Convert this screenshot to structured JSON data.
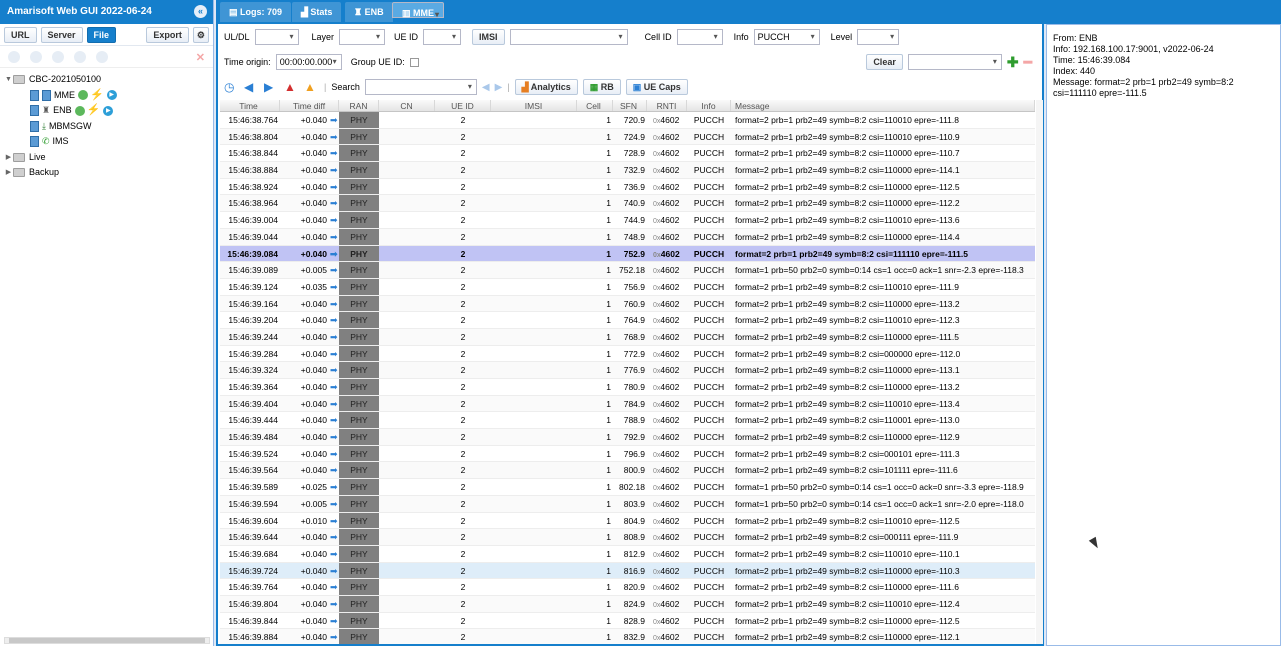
{
  "app": {
    "title": "Amarisoft Web GUI 2022-06-24"
  },
  "left_toolbar": {
    "url": "URL",
    "server": "Server",
    "file": "File",
    "export": "Export"
  },
  "tree": {
    "root": "CBC-2021050100",
    "nodes": [
      {
        "label": "MME",
        "icon": "server-icon"
      },
      {
        "label": "ENB",
        "icon": "antenna-icon"
      },
      {
        "label": "MBMSGW",
        "icon": "download-icon"
      },
      {
        "label": "IMS",
        "icon": "phone-icon"
      }
    ],
    "live": "Live",
    "backup": "Backup"
  },
  "tabs": [
    {
      "label": "Logs: 709",
      "icon": "list-icon"
    },
    {
      "label": "Stats",
      "icon": "chart-icon"
    },
    {
      "label": "ENB",
      "icon": "antenna-icon"
    },
    {
      "label": "MME",
      "icon": "server-icon"
    }
  ],
  "filters": {
    "uldl_label": "UL/DL",
    "layer_label": "Layer",
    "ueid_label": "UE ID",
    "imsi_label": "IMSI",
    "cellid_label": "Cell ID",
    "info_label": "Info",
    "info_value": "PUCCH",
    "level_label": "Level",
    "time_origin_label": "Time origin:",
    "time_origin_value": "00:00:00.000",
    "group_ueid_label": "Group UE ID:",
    "clear": "Clear",
    "search_label": "Search",
    "analytics": "Analytics",
    "rb": "RB",
    "uecaps": "UE Caps"
  },
  "columns": [
    "Time",
    "Time diff",
    "RAN",
    "CN",
    "UE ID",
    "IMSI",
    "Cell",
    "SFN",
    "RNTI",
    "Info",
    "Message"
  ],
  "rows": [
    [
      "15:46:38.764",
      "+0.040",
      "PHY",
      "2",
      "1",
      "720.9",
      "0x",
      "4602",
      "PUCCH",
      "format=2 prb=1 prb2=49 symb=8:2 csi=110010 epre=-111.8"
    ],
    [
      "15:46:38.804",
      "+0.040",
      "PHY",
      "2",
      "1",
      "724.9",
      "0x",
      "4602",
      "PUCCH",
      "format=2 prb=1 prb2=49 symb=8:2 csi=110010 epre=-110.9"
    ],
    [
      "15:46:38.844",
      "+0.040",
      "PHY",
      "2",
      "1",
      "728.9",
      "0x",
      "4602",
      "PUCCH",
      "format=2 prb=1 prb2=49 symb=8:2 csi=110000 epre=-110.7"
    ],
    [
      "15:46:38.884",
      "+0.040",
      "PHY",
      "2",
      "1",
      "732.9",
      "0x",
      "4602",
      "PUCCH",
      "format=2 prb=1 prb2=49 symb=8:2 csi=110000 epre=-114.1"
    ],
    [
      "15:46:38.924",
      "+0.040",
      "PHY",
      "2",
      "1",
      "736.9",
      "0x",
      "4602",
      "PUCCH",
      "format=2 prb=1 prb2=49 symb=8:2 csi=110000 epre=-112.5"
    ],
    [
      "15:46:38.964",
      "+0.040",
      "PHY",
      "2",
      "1",
      "740.9",
      "0x",
      "4602",
      "PUCCH",
      "format=2 prb=1 prb2=49 symb=8:2 csi=110000 epre=-112.2"
    ],
    [
      "15:46:39.004",
      "+0.040",
      "PHY",
      "2",
      "1",
      "744.9",
      "0x",
      "4602",
      "PUCCH",
      "format=2 prb=1 prb2=49 symb=8:2 csi=110010 epre=-113.6"
    ],
    [
      "15:46:39.044",
      "+0.040",
      "PHY",
      "2",
      "1",
      "748.9",
      "0x",
      "4602",
      "PUCCH",
      "format=2 prb=1 prb2=49 symb=8:2 csi=110000 epre=-114.4"
    ],
    [
      "15:46:39.084",
      "+0.040",
      "PHY",
      "2",
      "1",
      "752.9",
      "0x",
      "4602",
      "PUCCH",
      "format=2 prb=1 prb2=49 symb=8:2 csi=111110 epre=-111.5"
    ],
    [
      "15:46:39.089",
      "+0.005",
      "PHY",
      "2",
      "1",
      "752.18",
      "0x",
      "4602",
      "PUCCH",
      "format=1 prb=50 prb2=0 symb=0:14 cs=1 occ=0 ack=1 snr=-2.3 epre=-118.3"
    ],
    [
      "15:46:39.124",
      "+0.035",
      "PHY",
      "2",
      "1",
      "756.9",
      "0x",
      "4602",
      "PUCCH",
      "format=2 prb=1 prb2=49 symb=8:2 csi=110010 epre=-111.9"
    ],
    [
      "15:46:39.164",
      "+0.040",
      "PHY",
      "2",
      "1",
      "760.9",
      "0x",
      "4602",
      "PUCCH",
      "format=2 prb=1 prb2=49 symb=8:2 csi=110000 epre=-113.2"
    ],
    [
      "15:46:39.204",
      "+0.040",
      "PHY",
      "2",
      "1",
      "764.9",
      "0x",
      "4602",
      "PUCCH",
      "format=2 prb=1 prb2=49 symb=8:2 csi=110010 epre=-112.3"
    ],
    [
      "15:46:39.244",
      "+0.040",
      "PHY",
      "2",
      "1",
      "768.9",
      "0x",
      "4602",
      "PUCCH",
      "format=2 prb=1 prb2=49 symb=8:2 csi=110000 epre=-111.5"
    ],
    [
      "15:46:39.284",
      "+0.040",
      "PHY",
      "2",
      "1",
      "772.9",
      "0x",
      "4602",
      "PUCCH",
      "format=2 prb=1 prb2=49 symb=8:2 csi=000000 epre=-112.0"
    ],
    [
      "15:46:39.324",
      "+0.040",
      "PHY",
      "2",
      "1",
      "776.9",
      "0x",
      "4602",
      "PUCCH",
      "format=2 prb=1 prb2=49 symb=8:2 csi=110000 epre=-113.1"
    ],
    [
      "15:46:39.364",
      "+0.040",
      "PHY",
      "2",
      "1",
      "780.9",
      "0x",
      "4602",
      "PUCCH",
      "format=2 prb=1 prb2=49 symb=8:2 csi=110000 epre=-113.2"
    ],
    [
      "15:46:39.404",
      "+0.040",
      "PHY",
      "2",
      "1",
      "784.9",
      "0x",
      "4602",
      "PUCCH",
      "format=2 prb=1 prb2=49 symb=8:2 csi=110010 epre=-113.4"
    ],
    [
      "15:46:39.444",
      "+0.040",
      "PHY",
      "2",
      "1",
      "788.9",
      "0x",
      "4602",
      "PUCCH",
      "format=2 prb=1 prb2=49 symb=8:2 csi=110001 epre=-113.0"
    ],
    [
      "15:46:39.484",
      "+0.040",
      "PHY",
      "2",
      "1",
      "792.9",
      "0x",
      "4602",
      "PUCCH",
      "format=2 prb=1 prb2=49 symb=8:2 csi=110000 epre=-112.9"
    ],
    [
      "15:46:39.524",
      "+0.040",
      "PHY",
      "2",
      "1",
      "796.9",
      "0x",
      "4602",
      "PUCCH",
      "format=2 prb=1 prb2=49 symb=8:2 csi=000101 epre=-111.3"
    ],
    [
      "15:46:39.564",
      "+0.040",
      "PHY",
      "2",
      "1",
      "800.9",
      "0x",
      "4602",
      "PUCCH",
      "format=2 prb=1 prb2=49 symb=8:2 csi=101111 epre=-111.6"
    ],
    [
      "15:46:39.589",
      "+0.025",
      "PHY",
      "2",
      "1",
      "802.18",
      "0x",
      "4602",
      "PUCCH",
      "format=1 prb=50 prb2=0 symb=0:14 cs=1 occ=0 ack=0 snr=-3.3 epre=-118.9"
    ],
    [
      "15:46:39.594",
      "+0.005",
      "PHY",
      "2",
      "1",
      "803.9",
      "0x",
      "4602",
      "PUCCH",
      "format=1 prb=50 prb2=0 symb=0:14 cs=1 occ=0 ack=1 snr=-2.0 epre=-118.0"
    ],
    [
      "15:46:39.604",
      "+0.010",
      "PHY",
      "2",
      "1",
      "804.9",
      "0x",
      "4602",
      "PUCCH",
      "format=2 prb=1 prb2=49 symb=8:2 csi=110010 epre=-112.5"
    ],
    [
      "15:46:39.644",
      "+0.040",
      "PHY",
      "2",
      "1",
      "808.9",
      "0x",
      "4602",
      "PUCCH",
      "format=2 prb=1 prb2=49 symb=8:2 csi=000111 epre=-111.9"
    ],
    [
      "15:46:39.684",
      "+0.040",
      "PHY",
      "2",
      "1",
      "812.9",
      "0x",
      "4602",
      "PUCCH",
      "format=2 prb=1 prb2=49 symb=8:2 csi=110010 epre=-110.1"
    ],
    [
      "15:46:39.724",
      "+0.040",
      "PHY",
      "2",
      "1",
      "816.9",
      "0x",
      "4602",
      "PUCCH",
      "format=2 prb=1 prb2=49 symb=8:2 csi=110000 epre=-110.3"
    ],
    [
      "15:46:39.764",
      "+0.040",
      "PHY",
      "2",
      "1",
      "820.9",
      "0x",
      "4602",
      "PUCCH",
      "format=2 prb=1 prb2=49 symb=8:2 csi=110000 epre=-111.6"
    ],
    [
      "15:46:39.804",
      "+0.040",
      "PHY",
      "2",
      "1",
      "824.9",
      "0x",
      "4602",
      "PUCCH",
      "format=2 prb=1 prb2=49 symb=8:2 csi=110010 epre=-112.4"
    ],
    [
      "15:46:39.844",
      "+0.040",
      "PHY",
      "2",
      "1",
      "828.9",
      "0x",
      "4602",
      "PUCCH",
      "format=2 prb=1 prb2=49 symb=8:2 csi=110000 epre=-112.5"
    ],
    [
      "15:46:39.884",
      "+0.040",
      "PHY",
      "2",
      "1",
      "832.9",
      "0x",
      "4602",
      "PUCCH",
      "format=2 prb=1 prb2=49 symb=8:2 csi=110000 epre=-112.1"
    ]
  ],
  "selected_row": 8,
  "hover_row": 27,
  "detail": {
    "from": "From: ENB",
    "info": "Info: 192.168.100.17:9001, v2022-06-24",
    "time": "Time: 15:46:39.084",
    "index": "Index: 440",
    "message": "Message: format=2 prb=1 prb2=49 symb=8:2 csi=111110 epre=-111.5"
  },
  "colors": {
    "accent": "#157fcc",
    "selected": "#c0c3f4",
    "ran_cell": "#808080"
  }
}
